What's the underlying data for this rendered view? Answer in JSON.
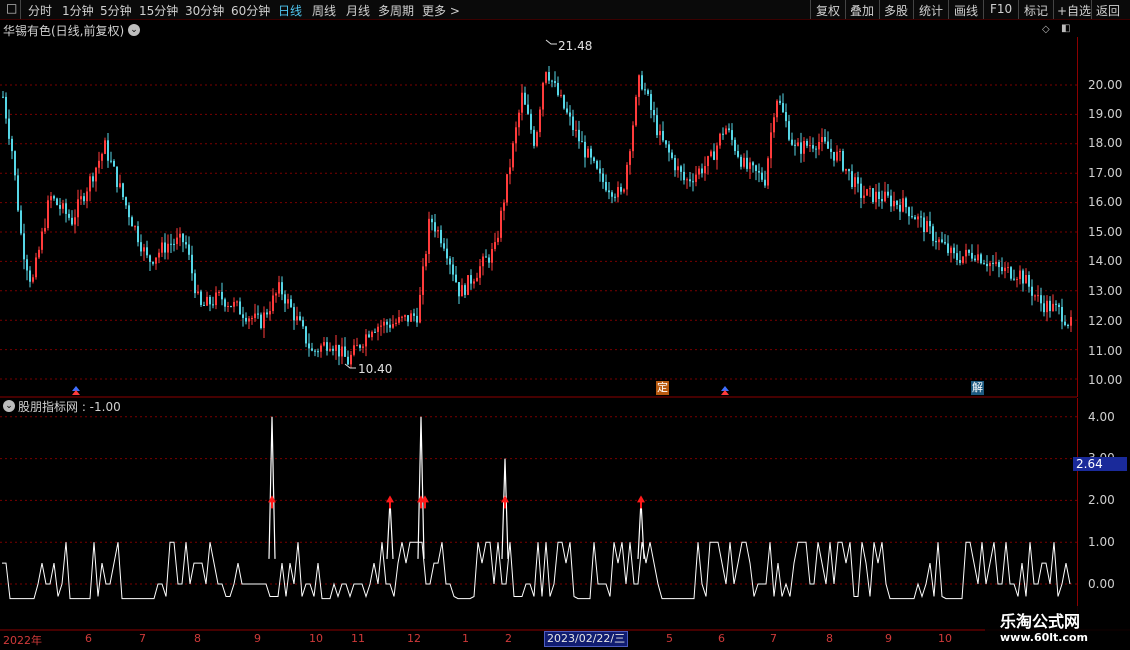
{
  "toolbar": {
    "left_icon": "□",
    "periods": [
      "分时",
      "1分钟",
      "5分钟",
      "15分钟",
      "30分钟",
      "60分钟",
      "日线",
      "周线",
      "月线",
      "多周期",
      "更多 >"
    ],
    "active_period": "日线",
    "right": [
      "复权",
      "叠加",
      "多股",
      "统计",
      "画线",
      "F10",
      "标记",
      "+自选",
      "返回"
    ]
  },
  "main_header": {
    "title": "华锡有色(日线,前复权)"
  },
  "price_chart": {
    "y_labels": [
      "20.00",
      "19.00",
      "18.00",
      "17.00",
      "16.00",
      "15.00",
      "14.00",
      "13.00",
      "12.00",
      "11.00",
      "10.00"
    ],
    "high_label": "21.48",
    "low_label": "10.40",
    "signals": [
      "定",
      "解"
    ]
  },
  "indicator": {
    "title": "股朋指标网 : -1.00",
    "y_labels": [
      "4.00",
      "3.00",
      "2.00",
      "1.00",
      "0.00"
    ],
    "current_value": "2.64"
  },
  "x_axis": {
    "labels": [
      "2022年",
      "6",
      "7",
      "8",
      "9",
      "10",
      "11",
      "12",
      "1",
      "2",
      "5",
      "6",
      "7",
      "8",
      "9",
      "10"
    ],
    "cursor_date": "2023/02/22/三"
  },
  "watermark": {
    "title": "乐淘公式网",
    "url": "www.60lt.com"
  },
  "colors": {
    "up": "#ff3b3b",
    "down": "#56d6e6",
    "grid": "#7a0000",
    "axis": "#8b0000",
    "signal": "#ff1a1a"
  },
  "chart_data": {
    "type": "candlestick",
    "price_range": [
      9.6,
      22.2
    ],
    "indicator_range": [
      -0.7,
      4.3
    ],
    "indicator_arrows_at_value": 2.0,
    "indicator_spikes": [
      4.0,
      2.0,
      4.0,
      3.0,
      2.0
    ]
  }
}
